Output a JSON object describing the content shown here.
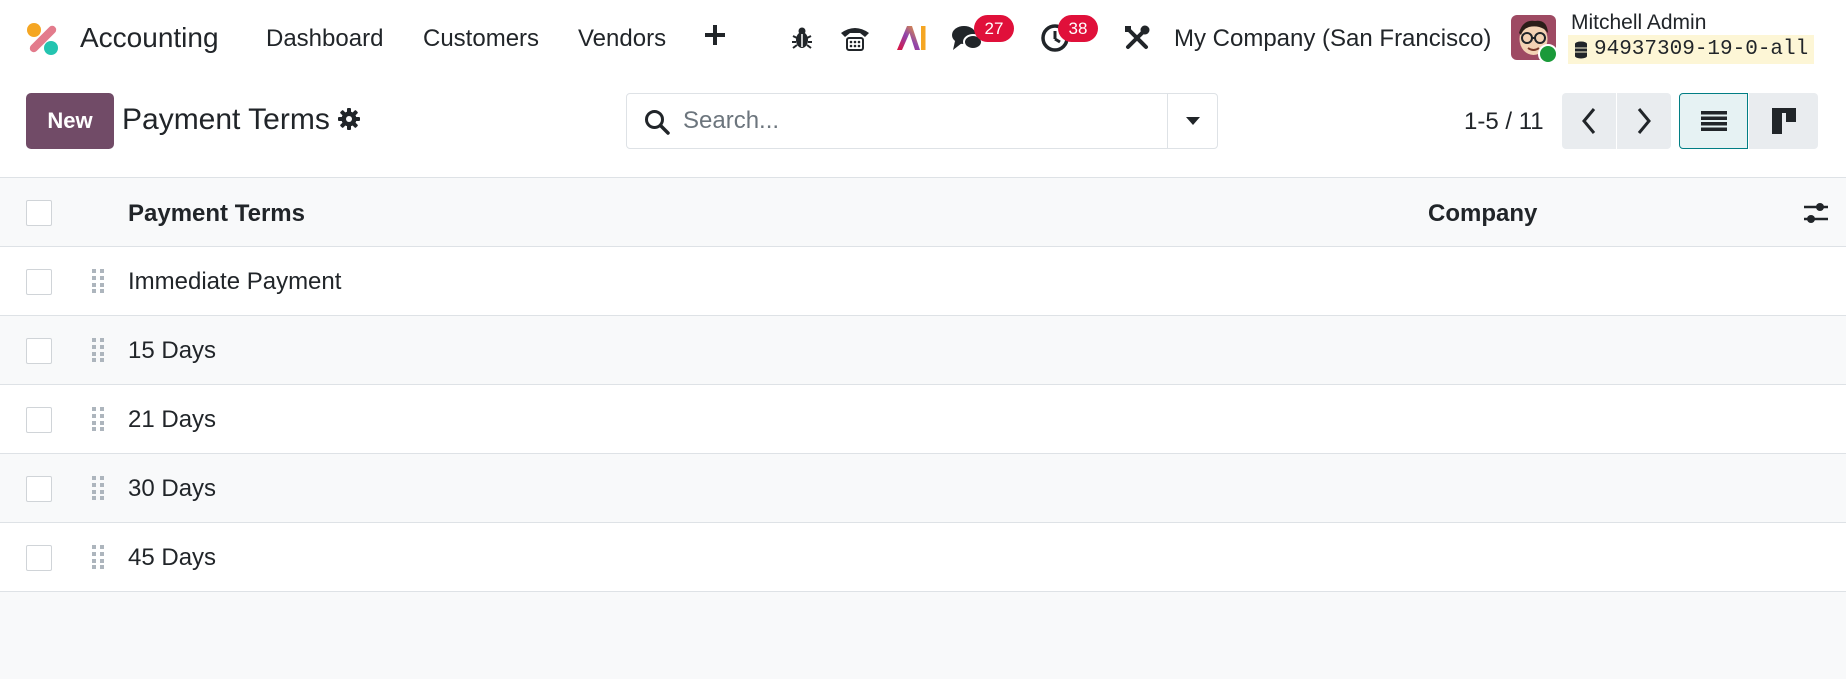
{
  "navbar": {
    "app_name": "Accounting",
    "menu": [
      "Dashboard",
      "Customers",
      "Vendors"
    ],
    "icons": [
      "app-logo-icon",
      "plus-icon",
      "bug-icon",
      "phone-icon",
      "ai-icon",
      "chat-icon",
      "clock-icon",
      "tools-icon"
    ],
    "messages_count": "27",
    "activities_count": "38",
    "company": "My Company (San Francisco)",
    "user_name": "Mitchell Admin",
    "database": "94937309-19-0-all"
  },
  "control_panel": {
    "new_label": "New",
    "title": "Payment Terms",
    "search_placeholder": "Search...",
    "pager": "1-5 / 11"
  },
  "list": {
    "columns": [
      "Payment Terms",
      "Company"
    ],
    "rows": [
      {
        "name": "Immediate Payment",
        "company": ""
      },
      {
        "name": "15 Days",
        "company": ""
      },
      {
        "name": "21 Days",
        "company": ""
      },
      {
        "name": "30 Days",
        "company": ""
      },
      {
        "name": "45 Days",
        "company": ""
      }
    ]
  },
  "colors": {
    "brand": "#714b67",
    "badge": "#e0103a",
    "active_view": "#017e84"
  }
}
